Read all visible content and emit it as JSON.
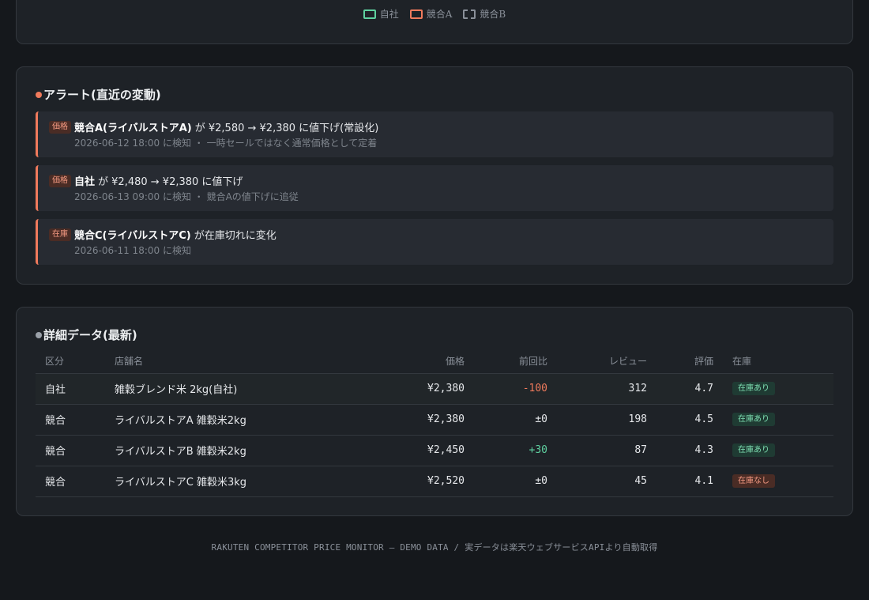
{
  "legend": {
    "items": [
      {
        "label": "自社"
      },
      {
        "label": "競合A"
      },
      {
        "label": "競合B"
      }
    ]
  },
  "alerts": {
    "title": "アラート(直近の変動)",
    "items": [
      {
        "tag": "価格",
        "subject": "競合A(ライバルストアA)",
        "text": "が ¥2,580 → ¥2,380 に値下げ(常設化)",
        "time": "2026-06-12 18:00",
        "meta": " に検知 ・ 一時セールではなく通常価格として定着"
      },
      {
        "tag": "価格",
        "subject": "自社",
        "text": "が ¥2,480 → ¥2,380 に値下げ",
        "time": "2026-06-13 09:00",
        "meta": " に検知 ・ 競合Aの値下げに追従"
      },
      {
        "tag": "在庫",
        "subject": "競合C(ライバルストアC)",
        "text": "が在庫切れに変化",
        "time": "2026-06-11 18:00",
        "meta": " に検知"
      }
    ]
  },
  "details": {
    "title": "詳細データ(最新)",
    "columns": [
      "区分",
      "店舗名",
      "価格",
      "前回比",
      "レビュー",
      "評価",
      "在庫"
    ],
    "rows": [
      {
        "kind": "自社",
        "store": "雑穀ブレンド米 2kg(自社)",
        "price": "¥2,380",
        "change": "-100",
        "reviews": "312",
        "rating": "4.7",
        "stock": "在庫あり"
      },
      {
        "kind": "競合",
        "store": "ライバルストアA 雑穀米2kg",
        "price": "¥2,380",
        "change": "±0",
        "reviews": "198",
        "rating": "4.5",
        "stock": "在庫あり"
      },
      {
        "kind": "競合",
        "store": "ライバルストアB 雑穀米2kg",
        "price": "¥2,450",
        "change": "+30",
        "reviews": "87",
        "rating": "4.3",
        "stock": "在庫あり"
      },
      {
        "kind": "競合",
        "store": "ライバルストアC 雑穀米3kg",
        "price": "¥2,520",
        "change": "±0",
        "reviews": "45",
        "rating": "4.1",
        "stock": "在庫なし"
      }
    ]
  },
  "footer": {
    "text": "RAKUTEN COMPETITOR PRICE MONITOR — DEMO DATA / 実データは楽天ウェブサービスAPIより自動取得"
  },
  "colors": {
    "self": "#5fd1a0",
    "competitor_a": "#f07a5c",
    "competitor_b": "#8a9099",
    "alert_accent": "#f07a5c"
  }
}
